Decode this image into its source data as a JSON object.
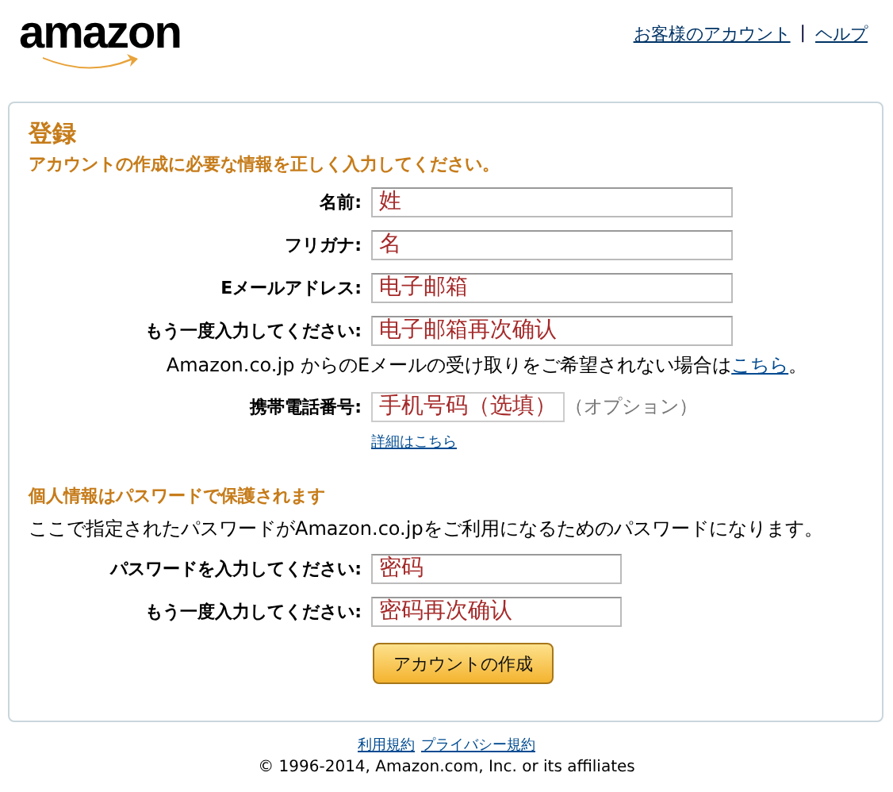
{
  "header": {
    "logo": "amazon",
    "links": [
      "お客様のアカウント",
      "ヘルプ"
    ],
    "separator": "|"
  },
  "panel": {
    "title": "登録",
    "subtitle": "アカウントの作成に必要な情報を正しく入力してください。",
    "fields": [
      {
        "label": "名前:",
        "value": "姓"
      },
      {
        "label": "フリガナ:",
        "value": "名"
      },
      {
        "label": "Eメールアドレス:",
        "value": "电子邮箱"
      },
      {
        "label": "もう一度入力してください:",
        "value": "电子邮箱再次确认"
      }
    ],
    "email_note": {
      "text": "Amazon.co.jp からのEメールの受け取りをご希望されない場合は",
      "link": "こちら",
      "end": "。"
    },
    "phone": {
      "label": "携帯電話番号:",
      "value": "手机号码（选填）",
      "hint": "（オプション）",
      "detail_link": "詳細はこちら"
    },
    "password_section": {
      "heading": "個人情報はパスワードで保護されます",
      "description": "ここで指定されたパスワードがAmazon.co.jpをご利用になるためのパスワードになります。",
      "fields": [
        {
          "label": "パスワードを入力してください:",
          "value": "密码"
        },
        {
          "label": "もう一度入力してください:",
          "value": "密码再次确认"
        }
      ]
    },
    "button": "アカウントの作成"
  },
  "footer": {
    "links": [
      "利用規約",
      "プライバシー規約"
    ],
    "copyright": "© 1996-2014, Amazon.com, Inc. or its affiliates"
  }
}
